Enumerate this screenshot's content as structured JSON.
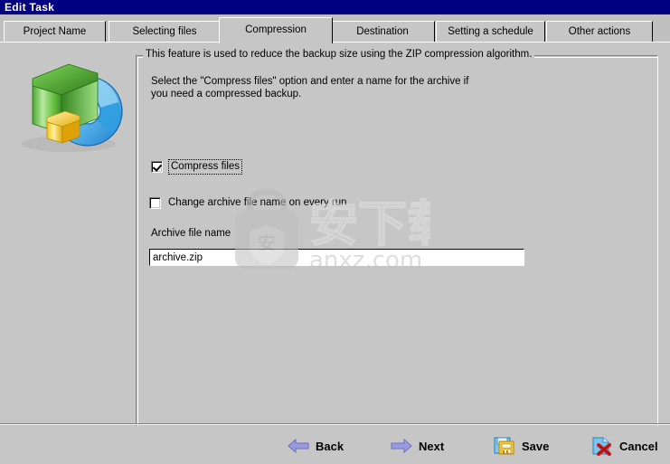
{
  "window": {
    "title": "Edit Task"
  },
  "tabs": [
    {
      "label": "Project Name",
      "active": false
    },
    {
      "label": "Selecting files",
      "active": false
    },
    {
      "label": "Compression",
      "active": true
    },
    {
      "label": "Destination",
      "active": false
    },
    {
      "label": "Setting a schedule",
      "active": false
    },
    {
      "label": "Other actions",
      "active": false
    }
  ],
  "panel": {
    "illustration_icon": "green-box-cd-icon",
    "group_legend": "This feature is used to reduce the backup size using the ZIP compression algorithm.",
    "paragraph": "Select the \"Compress files\" option and enter a name for the archive if\nyou need a compressed backup.",
    "compress_files": {
      "label": "Compress files",
      "checked": true,
      "focused": true
    },
    "change_archive_name": {
      "label": "Change archive file name on every run",
      "checked": false,
      "focused": false
    },
    "archive_field": {
      "label": "Archive file name",
      "value": "archive.zip",
      "placeholder": ""
    }
  },
  "watermark": {
    "text_cn": "安下载",
    "text_domain": "anxz.com",
    "shield_glyph": "安",
    "icon": "lock-shield-watermark-icon"
  },
  "footer": {
    "buttons": [
      {
        "label": "Back",
        "icon": "arrow-left-icon"
      },
      {
        "label": "Next",
        "icon": "arrow-right-icon"
      },
      {
        "label": "Save",
        "icon": "floppy-disk-icon"
      },
      {
        "label": "Cancel",
        "icon": "red-x-page-icon"
      }
    ]
  },
  "colors": {
    "titlebar": "#000080",
    "titlebar_text": "#ffffff",
    "face": "#c6c6c6",
    "panel": "#c6c6c6",
    "field_bg": "#ffffff",
    "text": "#000000",
    "arrow": "#8a8ad0",
    "cancel_x": "#cc2020"
  }
}
